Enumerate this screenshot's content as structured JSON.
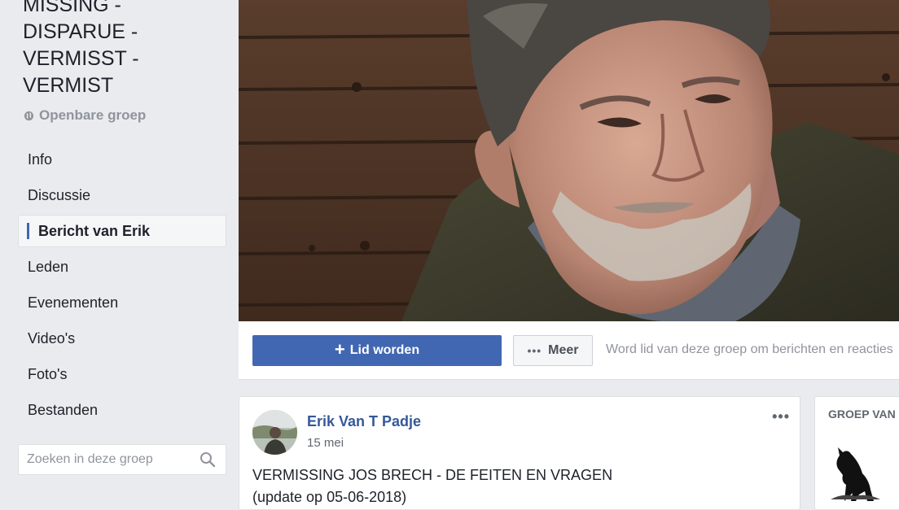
{
  "group": {
    "title_lines": [
      "MISSING -",
      "DISPARUE -",
      "VERMISST -",
      "VERMIST"
    ],
    "privacy_label": "Openbare groep"
  },
  "sidebar": {
    "items": [
      {
        "label": "Info",
        "active": false
      },
      {
        "label": "Discussie",
        "active": false
      },
      {
        "label": "Bericht van Erik",
        "active": true
      },
      {
        "label": "Leden",
        "active": false
      },
      {
        "label": "Evenementen",
        "active": false
      },
      {
        "label": "Video's",
        "active": false
      },
      {
        "label": "Foto's",
        "active": false
      },
      {
        "label": "Bestanden",
        "active": false
      }
    ],
    "search_placeholder": "Zoeken in deze groep"
  },
  "actions": {
    "join_label": "Lid worden",
    "more_label": "Meer",
    "join_hint": "Word lid van deze groep om berichten en reacties"
  },
  "post": {
    "author": "Erik Van T Padje",
    "date": "15 mei",
    "text_line1": "VERMISSING JOS BRECH - DE FEITEN EN VRAGEN",
    "text_line2": "(update op 05-06-2018)",
    "options_glyph": "•••"
  },
  "right_column": {
    "title": "GROEP VAN"
  },
  "colors": {
    "accent": "#4267b2",
    "link": "#365899",
    "page_bg": "#e9ebee"
  },
  "icons": [
    "globe-icon",
    "search-icon",
    "plus-icon",
    "dots-icon",
    "post-options-icon",
    "wolf-icon"
  ]
}
